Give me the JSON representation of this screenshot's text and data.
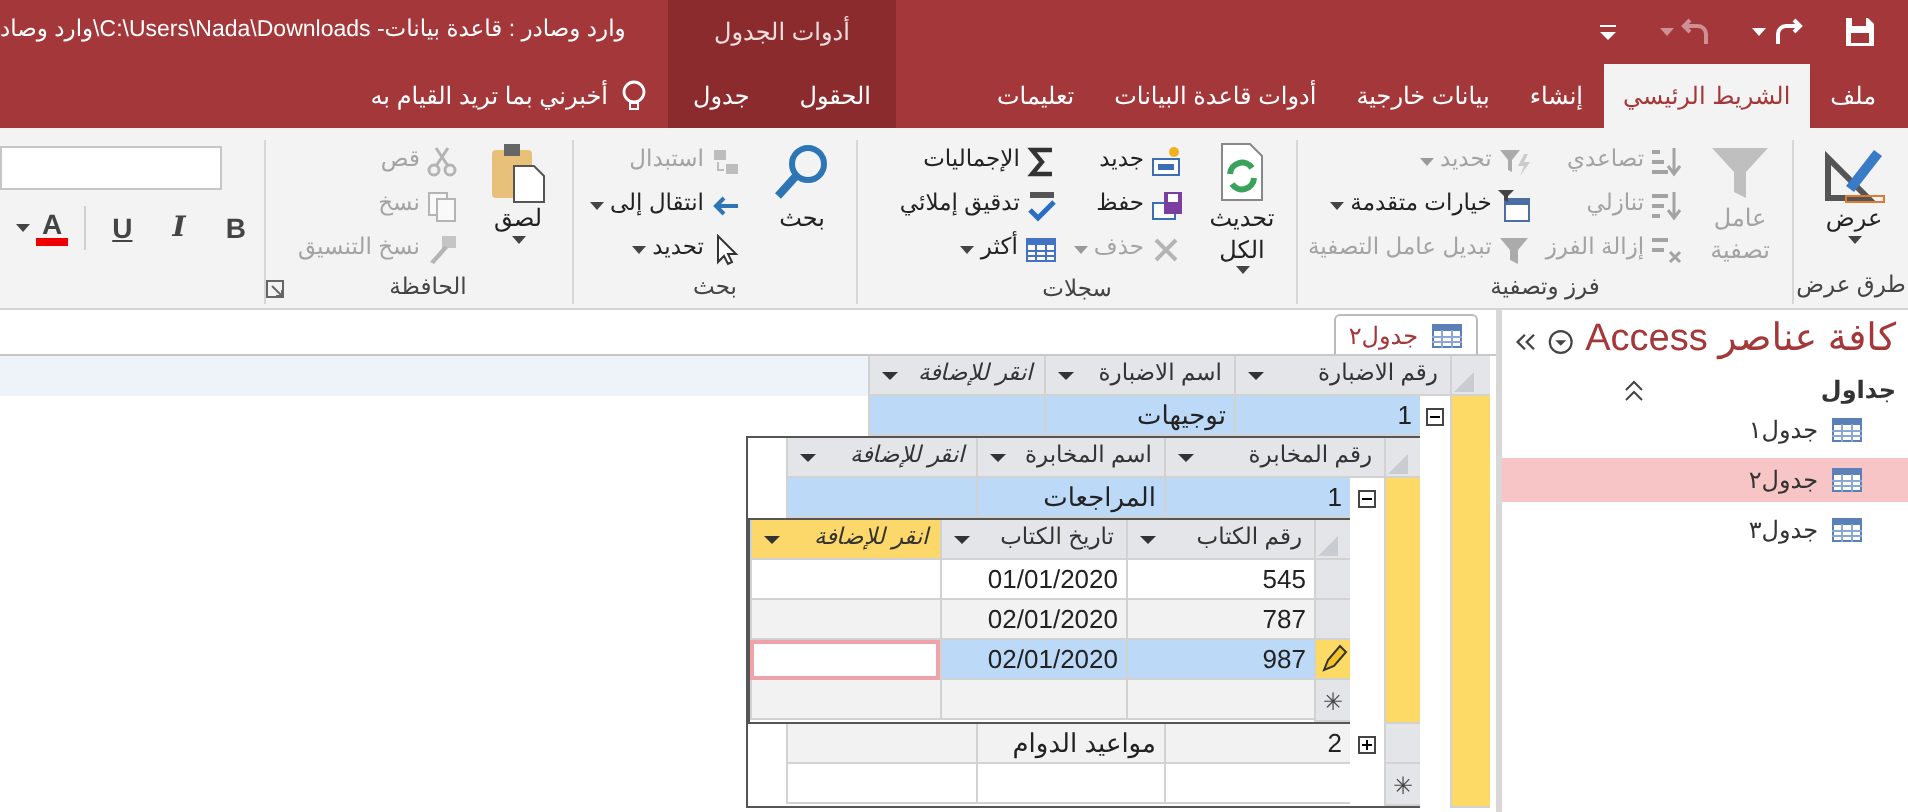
{
  "title_bar": {
    "title": "وارد وصادر : قاعدة بيانات- C:\\Users\\Nada\\Downloads\\وارد وصاد",
    "context_label": "أدوات الجدول",
    "quick_access": [
      {
        "disabled": false,
        "dropdown": false
      },
      {
        "disabled": false,
        "dropdown": true
      },
      {
        "disabled": true,
        "dropdown": true
      },
      {
        "disabled": false,
        "dropdown": false
      }
    ]
  },
  "tabs": [
    {
      "label": "ملف",
      "selected": false
    },
    {
      "label": "الشريط الرئيسي",
      "selected": true
    },
    {
      "label": "إنشاء",
      "selected": false
    },
    {
      "label": "بيانات خارجية",
      "selected": false
    },
    {
      "label": "أدوات قاعدة البيانات",
      "selected": false
    },
    {
      "label": "تعليمات",
      "selected": false
    }
  ],
  "context_tabs": [
    {
      "label": "الحقول",
      "selected": false
    },
    {
      "label": "جدول",
      "selected": false
    }
  ],
  "tell_me": {
    "label": "أخبرني بما تريد القيام به"
  },
  "ribbon": {
    "groups": [
      {
        "label": "طرق عرض",
        "large": [
          {
            "label": "عرض",
            "dropdown": true,
            "disabled": false
          }
        ]
      },
      {
        "label": "فرز وتصفية",
        "large": [
          {
            "label": "عامل تصفية",
            "dropdown": false,
            "disabled": true
          }
        ],
        "columns": [
          [
            {
              "label": "تصاعدي",
              "dropdown": false,
              "disabled": true
            },
            {
              "label": "تنازلي",
              "dropdown": false,
              "disabled": true
            },
            {
              "label": "إزالة الفرز",
              "dropdown": false,
              "disabled": true
            }
          ],
          [
            {
              "label": "تحديد",
              "dropdown": true,
              "disabled": true
            },
            {
              "label": "خيارات متقدمة",
              "dropdown": true,
              "disabled": false
            },
            {
              "label": "تبديل عامل التصفية",
              "dropdown": false,
              "disabled": true
            }
          ]
        ]
      },
      {
        "label": "سجلات",
        "large": [
          {
            "label": "تحديث الكل",
            "dropdown": true,
            "disabled": false
          }
        ],
        "columns": [
          [
            {
              "label": "جديد",
              "dropdown": false,
              "disabled": false
            },
            {
              "label": "حفظ",
              "dropdown": false,
              "disabled": false
            },
            {
              "label": "حذف",
              "dropdown": true,
              "disabled": true
            }
          ],
          [
            {
              "label": "الإجماليات",
              "dropdown": false,
              "disabled": false
            },
            {
              "label": "تدقيق إملائي",
              "dropdown": false,
              "disabled": false
            },
            {
              "label": "أكثر",
              "dropdown": true,
              "disabled": false
            }
          ]
        ]
      },
      {
        "label": "بحث",
        "large": [
          {
            "label": "بحث",
            "dropdown": false,
            "disabled": false
          }
        ],
        "columns": [
          [
            {
              "label": "استبدال",
              "dropdown": false,
              "disabled": true
            },
            {
              "label": "انتقال إلى",
              "dropdown": true,
              "disabled": false
            },
            {
              "label": "تحديد",
              "dropdown": true,
              "disabled": false
            }
          ]
        ]
      },
      {
        "label": "الحافظة",
        "launcher": true,
        "large": [
          {
            "label": "لصق",
            "dropdown": true,
            "disabled": false
          }
        ],
        "columns": [
          [
            {
              "label": "قص",
              "dropdown": false,
              "disabled": true
            },
            {
              "label": "نسخ",
              "dropdown": false,
              "disabled": true
            },
            {
              "label": "نسخ التنسيق",
              "dropdown": false,
              "disabled": true
            }
          ]
        ]
      }
    ],
    "font_buttons": [
      {
        "label": "B",
        "kind": "bold",
        "dropdown": false
      },
      {
        "label": "I",
        "kind": "italic",
        "dropdown": false
      },
      {
        "label": "U",
        "kind": "underline",
        "dropdown": false
      },
      {
        "label": "A",
        "kind": "color",
        "dropdown": true
      }
    ]
  },
  "nav_pane": {
    "title": "كافة عناصر Access",
    "groups": [
      {
        "label": "جداول",
        "expanded": true,
        "items": [
          {
            "label": "جدول١",
            "selected": false
          },
          {
            "label": "جدول٢",
            "selected": true
          },
          {
            "label": "جدول٣",
            "selected": false
          }
        ]
      }
    ]
  },
  "document_tab": {
    "label": "جدول٢"
  },
  "datasheet": {
    "columns": [
      {
        "label": "رقم الاضبارة",
        "kind": "field",
        "selected": false
      },
      {
        "label": "اسم الاضبارة",
        "kind": "field",
        "selected": false
      },
      {
        "label": "انقر للإضافة",
        "kind": "add",
        "selected": false
      }
    ],
    "rows": [
      {
        "cells": [
          "1",
          "توجيهات"
        ],
        "selected": true,
        "editing": false,
        "expanded": true,
        "subsheet": {
          "columns": [
            {
              "label": "رقم المخابرة",
              "kind": "field",
              "selected": false
            },
            {
              "label": "اسم المخابرة",
              "kind": "field",
              "selected": false
            },
            {
              "label": "انقر للإضافة",
              "kind": "add",
              "selected": false
            }
          ],
          "rows": [
            {
              "cells": [
                "1",
                "المراجعات"
              ],
              "selected": true,
              "editing": false,
              "expanded": true,
              "subsheet": {
                "columns": [
                  {
                    "label": "رقم الكتاب",
                    "kind": "field",
                    "selected": false
                  },
                  {
                    "label": "تاريخ الكتاب",
                    "kind": "field",
                    "selected": false
                  },
                  {
                    "label": "انقر للإضافة",
                    "kind": "add",
                    "selected": true
                  }
                ],
                "rows": [
                  {
                    "cells": [
                      "545",
                      "01/01/2020"
                    ],
                    "selected": false,
                    "editing": false
                  },
                  {
                    "cells": [
                      "787",
                      "02/01/2020"
                    ],
                    "selected": false,
                    "editing": false
                  },
                  {
                    "cells": [
                      "987",
                      "02/01/2020"
                    ],
                    "selected": true,
                    "editing": true
                  }
                ],
                "new_row": "✳"
              }
            },
            {
              "cells": [
                "2",
                "مواعيد الدوام"
              ],
              "selected": false,
              "editing": false,
              "expanded": false
            }
          ],
          "new_row": "✳"
        }
      }
    ]
  }
}
